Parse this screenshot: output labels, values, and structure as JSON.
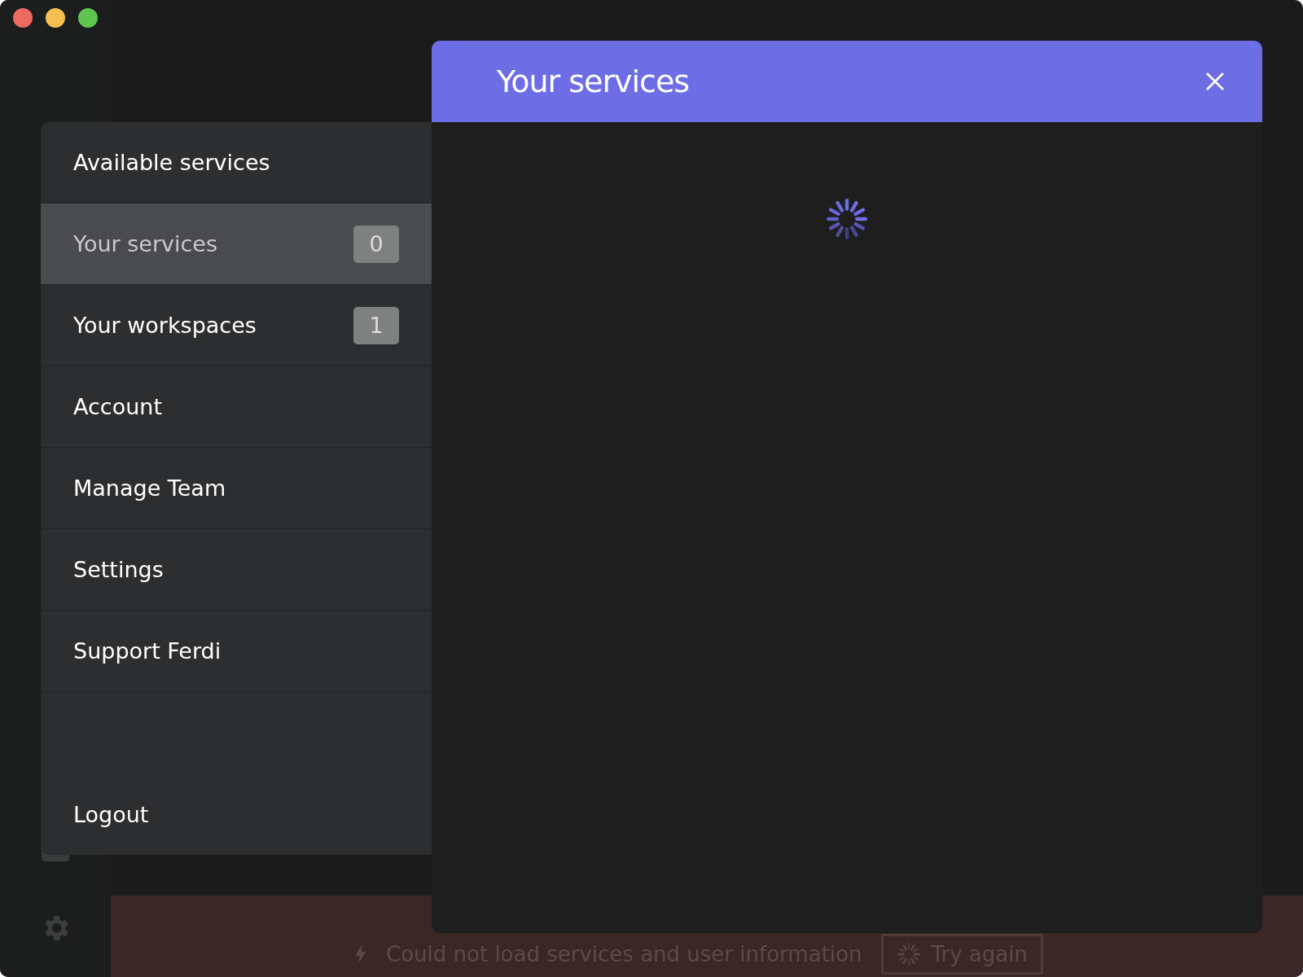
{
  "settings_menu": {
    "items": [
      {
        "label": "Available services",
        "selected": false
      },
      {
        "label": "Your services",
        "selected": true,
        "badge": "0"
      },
      {
        "label": "Your workspaces",
        "selected": false,
        "badge": "1"
      },
      {
        "label": "Account",
        "selected": false
      },
      {
        "label": "Manage Team",
        "selected": false
      },
      {
        "label": "Settings",
        "selected": false
      },
      {
        "label": "Support Ferdi",
        "selected": false
      }
    ],
    "logout": "Logout"
  },
  "modal": {
    "title": "Your services",
    "loading": true
  },
  "error_bar": {
    "message": "Could not load services and user information",
    "button": "Try again"
  }
}
